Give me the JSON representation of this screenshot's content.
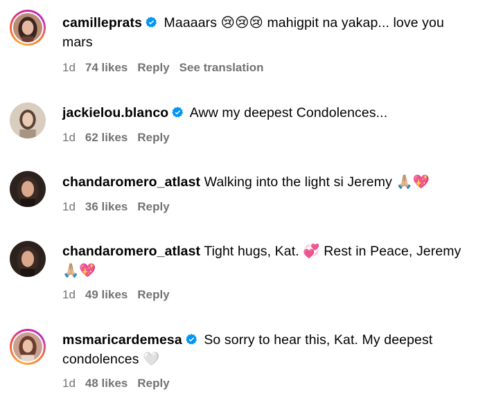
{
  "comments": [
    {
      "username": "camilleprats",
      "verified": true,
      "text_before": "Maaaars ",
      "emoji": "😢😢😢",
      "text_after": " mahigpit na yakap... love you mars",
      "time": "1d",
      "likes": "74 likes",
      "reply_label": "Reply",
      "translation_label": "See translation",
      "avatar_ring": true
    },
    {
      "username": "jackielou.blanco",
      "verified": true,
      "text_before": "Aww my deepest Condolences...",
      "emoji": "",
      "text_after": "",
      "time": "1d",
      "likes": "62 likes",
      "reply_label": "Reply",
      "avatar_ring": false
    },
    {
      "username": "chandaromero_atlast",
      "verified": false,
      "text_before": "Walking into the light si Jeremy ",
      "emoji": "🙏🏼💖",
      "text_after": "",
      "time": "1d",
      "likes": "36 likes",
      "reply_label": "Reply",
      "avatar_ring": false
    },
    {
      "username": "chandaromero_atlast",
      "verified": false,
      "text_before": "Tight hugs, Kat. ",
      "emoji": "💞",
      "text_after": " Rest in Peace, Jeremy ",
      "emoji2": "🙏🏼💖",
      "time": "1d",
      "likes": "49 likes",
      "reply_label": "Reply",
      "avatar_ring": false
    },
    {
      "username": "msmaricardemesa",
      "verified": true,
      "text_before": "So sorry to hear this, Kat. My deepest condolences ",
      "emoji": "🤍",
      "text_after": "",
      "time": "1d",
      "likes": "48 likes",
      "reply_label": "Reply",
      "avatar_ring": true
    }
  ],
  "colors": {
    "verified_blue": "#0095f6",
    "meta_gray": "#737373",
    "text": "#000000"
  },
  "icons": {
    "verified": "verified-badge-icon",
    "avatar": "profile-photo"
  }
}
